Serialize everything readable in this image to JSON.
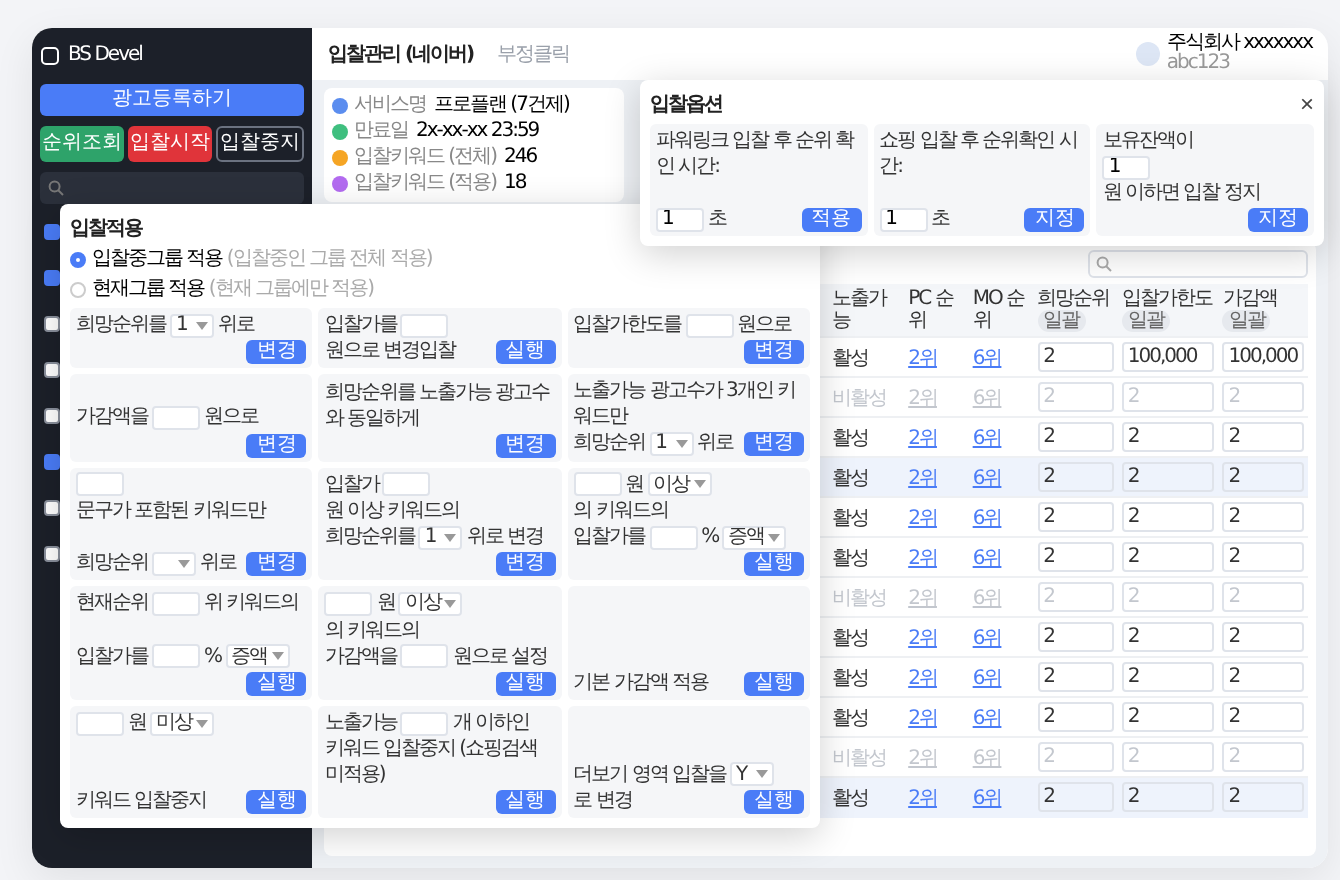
{
  "sidebar": {
    "logo": "BS Devel",
    "register_button": "광고등록하기",
    "actions": [
      {
        "label": "순위조회",
        "kind": "green"
      },
      {
        "label": "입찰시작",
        "kind": "red"
      },
      {
        "label": "입찰중지",
        "kind": "outline"
      }
    ],
    "groups": [
      {
        "checked": true
      },
      {
        "checked": true
      },
      {
        "checked": false
      },
      {
        "checked": false
      },
      {
        "checked": false
      },
      {
        "checked": true
      },
      {
        "checked": false
      },
      {
        "checked": false
      }
    ]
  },
  "header": {
    "tabs": [
      {
        "label": "입찰관리 (네이버)",
        "selected": true
      },
      {
        "label": "부정클릭",
        "selected": false
      }
    ],
    "user": {
      "company": "주식회사 xxxxxxx",
      "id": "abc123"
    }
  },
  "stats": [
    {
      "label": "서비스명",
      "value": "프로플랜 (7건제)",
      "color": "#5b8def"
    },
    {
      "label": "만료일",
      "value": "2x-xx-xx 23:59",
      "color": "#3fbf7f"
    },
    {
      "label": "입찰키워드 (전체)",
      "value": "246",
      "color": "#f5a524"
    },
    {
      "label": "입찰키워드 (적용)",
      "value": "18",
      "color": "#b36bf0"
    }
  ],
  "table": {
    "columns": [
      {
        "label": "노출가능"
      },
      {
        "label": "PC 순위"
      },
      {
        "label": "MO 순위"
      },
      {
        "label": "희망순위",
        "badge": "일괄"
      },
      {
        "label": "입찰가한도",
        "badge": "일괄"
      },
      {
        "label": "가감액",
        "badge": "일괄"
      }
    ],
    "rows": [
      {
        "exposure": "활성",
        "pc": "2위",
        "mo": "6위",
        "desired": "2",
        "limit": "100,000",
        "adjust": "100,000",
        "active": true,
        "selected": false
      },
      {
        "exposure": "비활성",
        "pc": "2위",
        "mo": "6위",
        "desired": "2",
        "limit": "2",
        "adjust": "2",
        "active": false,
        "selected": false
      },
      {
        "exposure": "활성",
        "pc": "2위",
        "mo": "6위",
        "desired": "2",
        "limit": "2",
        "adjust": "2",
        "active": true,
        "selected": false
      },
      {
        "exposure": "활성",
        "pc": "2위",
        "mo": "6위",
        "desired": "2",
        "limit": "2",
        "adjust": "2",
        "active": true,
        "selected": true
      },
      {
        "exposure": "활성",
        "pc": "2위",
        "mo": "6위",
        "desired": "2",
        "limit": "2",
        "adjust": "2",
        "active": true,
        "selected": false
      },
      {
        "exposure": "활성",
        "pc": "2위",
        "mo": "6위",
        "desired": "2",
        "limit": "2",
        "adjust": "2",
        "active": true,
        "selected": false
      },
      {
        "exposure": "비활성",
        "pc": "2위",
        "mo": "6위",
        "desired": "2",
        "limit": "2",
        "adjust": "2",
        "active": false,
        "selected": false
      },
      {
        "exposure": "활성",
        "pc": "2위",
        "mo": "6위",
        "desired": "2",
        "limit": "2",
        "adjust": "2",
        "active": true,
        "selected": false
      },
      {
        "exposure": "활성",
        "pc": "2위",
        "mo": "6위",
        "desired": "2",
        "limit": "2",
        "adjust": "2",
        "active": true,
        "selected": false
      },
      {
        "exposure": "활성",
        "pc": "2위",
        "mo": "6위",
        "desired": "2",
        "limit": "2",
        "adjust": "2",
        "active": true,
        "selected": false
      },
      {
        "exposure": "비활성",
        "pc": "2위",
        "mo": "6위",
        "desired": "2",
        "limit": "2",
        "adjust": "2",
        "active": false,
        "selected": false
      },
      {
        "exposure": "활성",
        "pc": "2위",
        "mo": "6위",
        "desired": "2",
        "limit": "2",
        "adjust": "2",
        "active": true,
        "selected": true
      }
    ]
  },
  "bid_options": {
    "title": "입찰옵션",
    "close": "×",
    "cards": [
      {
        "lines": [
          [
            {
              "kind": "text",
              "text": "파워링크 입찰 후 순위 확인 시간:"
            }
          ],
          [
            {
              "kind": "input",
              "value": "1"
            },
            {
              "kind": "text",
              "text": "초"
            }
          ]
        ],
        "button": "적용"
      },
      {
        "lines": [
          [
            {
              "kind": "text",
              "text": "쇼핑 입찰 후 순위확인 시간:"
            }
          ],
          [
            {
              "kind": "input",
              "value": "1"
            },
            {
              "kind": "text",
              "text": "초"
            }
          ]
        ],
        "button": "지정"
      },
      {
        "lines": [
          [
            {
              "kind": "text",
              "text": "보유잔액이"
            }
          ],
          [
            {
              "kind": "input",
              "value": "1"
            },
            {
              "kind": "text",
              "text": "원 이하면 입찰 정지"
            }
          ]
        ],
        "button": "지정"
      }
    ]
  },
  "bid_apply": {
    "title": "입찰적용",
    "scopes": [
      {
        "label": "입찰중그룹 적용",
        "note": "(입찰중인 그룹 전체 적용)",
        "selected": true
      },
      {
        "label": "현재그룹 적용",
        "note": "(현재 그룹에만 적용)",
        "selected": false
      }
    ],
    "cards": [
      {
        "lines": [
          [
            {
              "kind": "text",
              "text": "희망순위를"
            },
            {
              "kind": "select",
              "value": "1"
            },
            {
              "kind": "text",
              "text": "위로"
            }
          ]
        ],
        "button": "변경"
      },
      {
        "lines": [
          [
            {
              "kind": "text",
              "text": "입찰가를"
            },
            {
              "kind": "input"
            },
            {
              "kind": "text",
              "text": "원으로 변경입찰"
            }
          ]
        ],
        "button": "실행"
      },
      {
        "lines": [
          [
            {
              "kind": "text",
              "text": "입찰가한도를"
            },
            {
              "kind": "input"
            },
            {
              "kind": "text",
              "text": "원으로"
            }
          ]
        ],
        "button": "변경"
      },
      {
        "lines": [
          [
            {
              "kind": "text",
              "text": "가감액을"
            },
            {
              "kind": "input"
            },
            {
              "kind": "text",
              "text": "원으로"
            }
          ]
        ],
        "button": "변경"
      },
      {
        "lines": [
          [
            {
              "kind": "text",
              "text": "희망순위를 노출가능 광고수와 동일하게"
            }
          ]
        ],
        "button": "변경"
      },
      {
        "lines": [
          [
            {
              "kind": "text",
              "text": "노출가능 광고수가 3개인 키워드만"
            }
          ],
          [
            {
              "kind": "text",
              "text": "희망순위"
            },
            {
              "kind": "select",
              "value": "1"
            },
            {
              "kind": "text",
              "text": "위로"
            }
          ]
        ],
        "button": "변경"
      },
      {
        "lines": [
          [
            {
              "kind": "input"
            },
            {
              "kind": "text",
              "text": "문구가 포함된 키워드만"
            }
          ],
          [
            {
              "kind": "text",
              "text": "희망순위"
            },
            {
              "kind": "select"
            },
            {
              "kind": "text",
              "text": "위로"
            }
          ]
        ],
        "button": "변경"
      },
      {
        "lines": [
          [
            {
              "kind": "text",
              "text": "입찰가"
            },
            {
              "kind": "input"
            },
            {
              "kind": "text",
              "text": "원 이상 키워드의"
            }
          ],
          [
            {
              "kind": "text",
              "text": "희망순위를"
            },
            {
              "kind": "select",
              "value": "1"
            },
            {
              "kind": "text",
              "text": "위로 변경"
            }
          ]
        ],
        "button": "변경"
      },
      {
        "lines": [
          [
            {
              "kind": "input"
            },
            {
              "kind": "text",
              "text": "원"
            },
            {
              "kind": "select",
              "value": "이상"
            },
            {
              "kind": "text",
              "text": "의 키워드의"
            }
          ],
          [
            {
              "kind": "text",
              "text": "입찰가를"
            },
            {
              "kind": "input"
            },
            {
              "kind": "text",
              "text": "%"
            },
            {
              "kind": "select",
              "value": "증액"
            }
          ]
        ],
        "button": "실행"
      },
      {
        "lines": [
          [
            {
              "kind": "text",
              "text": "현재순위"
            },
            {
              "kind": "input"
            },
            {
              "kind": "text",
              "text": "위 키워드의"
            }
          ],
          [
            {
              "kind": "text",
              "text": "입찰가를"
            },
            {
              "kind": "input"
            },
            {
              "kind": "text",
              "text": "%"
            },
            {
              "kind": "select",
              "value": "증액"
            }
          ]
        ],
        "button": "실행"
      },
      {
        "lines": [
          [
            {
              "kind": "input"
            },
            {
              "kind": "text",
              "text": "원"
            },
            {
              "kind": "select",
              "value": "이상"
            },
            {
              "kind": "text",
              "text": "의 키워드의"
            }
          ],
          [
            {
              "kind": "text",
              "text": "가감액을"
            },
            {
              "kind": "input"
            },
            {
              "kind": "text",
              "text": "원으로 설정"
            }
          ]
        ],
        "button": "실행"
      },
      {
        "lines": [
          [
            {
              "kind": "text",
              "text": "기본 가감액 적용"
            }
          ]
        ],
        "button": "실행"
      },
      {
        "lines": [
          [
            {
              "kind": "input"
            },
            {
              "kind": "text",
              "text": "원"
            },
            {
              "kind": "select",
              "value": "미상"
            }
          ],
          [
            {
              "kind": "text",
              "text": "키워드 입찰중지"
            }
          ]
        ],
        "button": "실행"
      },
      {
        "lines": [
          [
            {
              "kind": "text",
              "text": "노출가능"
            },
            {
              "kind": "input"
            },
            {
              "kind": "text",
              "text": "개 이하인"
            }
          ],
          [
            {
              "kind": "text",
              "text": "키워드 입찰중지 (쇼핑검색 미적용)"
            }
          ]
        ],
        "button": "실행"
      },
      {
        "lines": [
          [
            {
              "kind": "text",
              "text": "더보기 영역 입찰을"
            },
            {
              "kind": "select",
              "value": "Y"
            },
            {
              "kind": "text",
              "text": "로 변경"
            }
          ]
        ],
        "button": "실행"
      }
    ]
  }
}
